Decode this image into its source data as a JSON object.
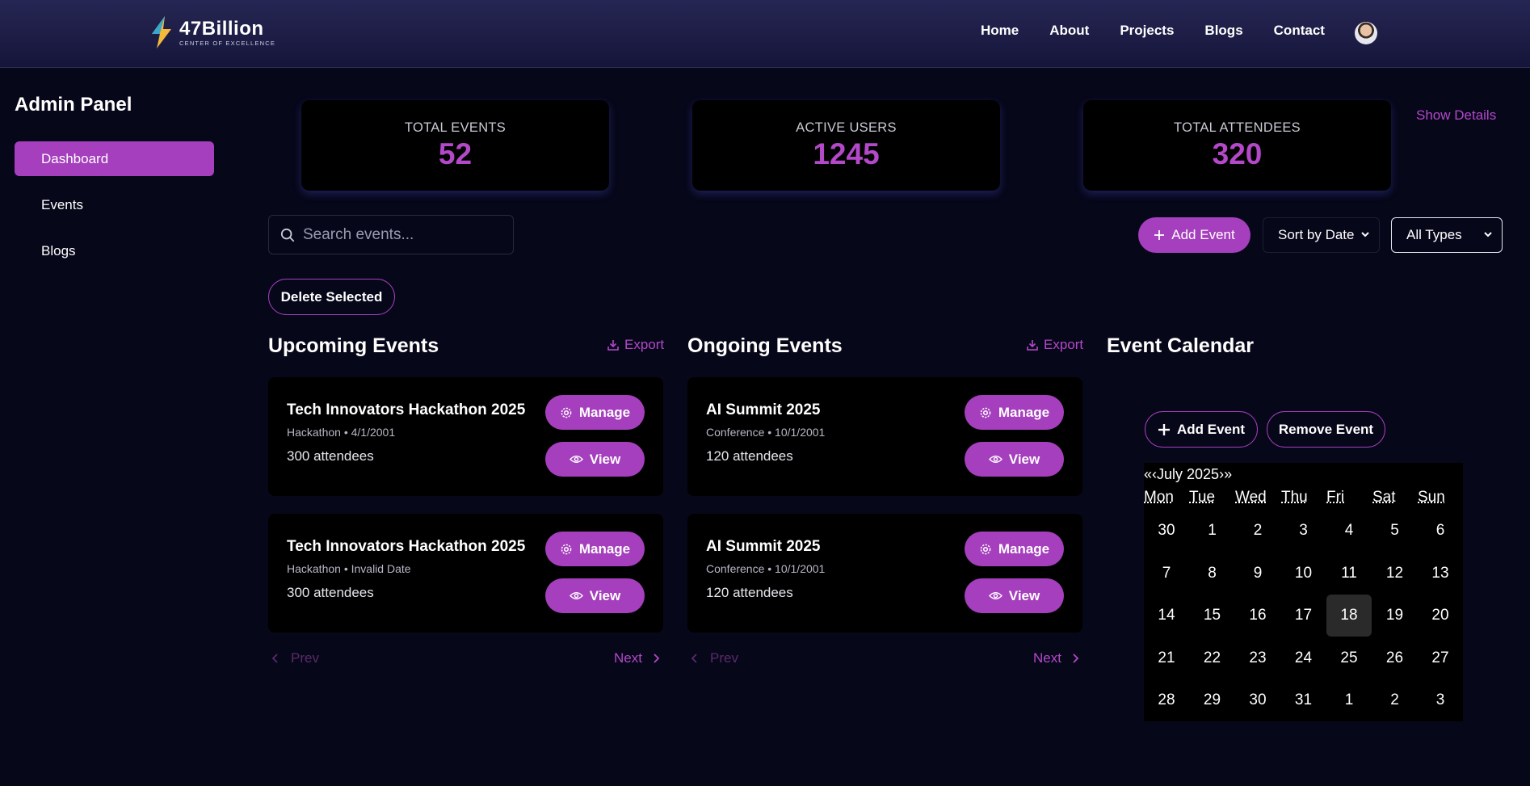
{
  "header": {
    "logo_title": "47Billion",
    "logo_subtitle": "CENTER OF EXCELLENCE",
    "nav": [
      "Home",
      "About",
      "Projects",
      "Blogs",
      "Contact"
    ]
  },
  "sidebar": {
    "title": "Admin Panel",
    "items": [
      {
        "label": "Dashboard",
        "active": true
      },
      {
        "label": "Events",
        "active": false
      },
      {
        "label": "Blogs",
        "active": false
      }
    ]
  },
  "stats": [
    {
      "label": "TOTAL EVENTS",
      "value": "52"
    },
    {
      "label": "ACTIVE USERS",
      "value": "1245"
    },
    {
      "label": "TOTAL ATTENDEES",
      "value": "320"
    }
  ],
  "show_details": "Show Details",
  "search": {
    "placeholder": "Search events..."
  },
  "toolbar": {
    "add_event": "Add Event",
    "sort_value": "Sort by Date",
    "type_value": "All Types",
    "delete_selected": "Delete Selected"
  },
  "upcoming": {
    "title": "Upcoming Events",
    "export": "Export",
    "cards": [
      {
        "title": "Tech Innovators Hackathon 2025",
        "meta": "Hackathon • 4/1/2001",
        "attendees": "300 attendees",
        "manage": "Manage",
        "view": "View"
      },
      {
        "title": "Tech Innovators Hackathon 2025",
        "meta": "Hackathon • Invalid Date",
        "attendees": "300 attendees",
        "manage": "Manage",
        "view": "View"
      }
    ],
    "prev": "Prev",
    "next": "Next"
  },
  "ongoing": {
    "title": "Ongoing Events",
    "export": "Export",
    "cards": [
      {
        "title": "AI Summit 2025",
        "meta": "Conference • 10/1/2001",
        "attendees": "120 attendees",
        "manage": "Manage",
        "view": "View"
      },
      {
        "title": "AI Summit 2025",
        "meta": "Conference • 10/1/2001",
        "attendees": "120 attendees",
        "manage": "Manage",
        "view": "View"
      }
    ],
    "prev": "Prev",
    "next": "Next"
  },
  "calendar": {
    "title": "Event Calendar",
    "add_event": "Add Event",
    "remove_event": "Remove Event",
    "prev_arrows": "«‹",
    "month_label": "July 2025",
    "next_arrows": "›»",
    "weekdays": [
      "Mon",
      "Tue",
      "Wed",
      "Thu",
      "Fri",
      "Sat",
      "Sun"
    ],
    "weeks": [
      [
        "30",
        "1",
        "2",
        "3",
        "4",
        "5",
        "6"
      ],
      [
        "7",
        "8",
        "9",
        "10",
        "11",
        "12",
        "13"
      ],
      [
        "14",
        "15",
        "16",
        "17",
        "18",
        "19",
        "20"
      ],
      [
        "21",
        "22",
        "23",
        "24",
        "25",
        "26",
        "27"
      ],
      [
        "28",
        "29",
        "30",
        "31",
        "1",
        "2",
        "3"
      ]
    ],
    "highlighted_day": "18"
  },
  "colors": {
    "accent": "#a53fbd",
    "accent_text": "#b348c9",
    "background": "#07071a",
    "card": "#000000"
  }
}
